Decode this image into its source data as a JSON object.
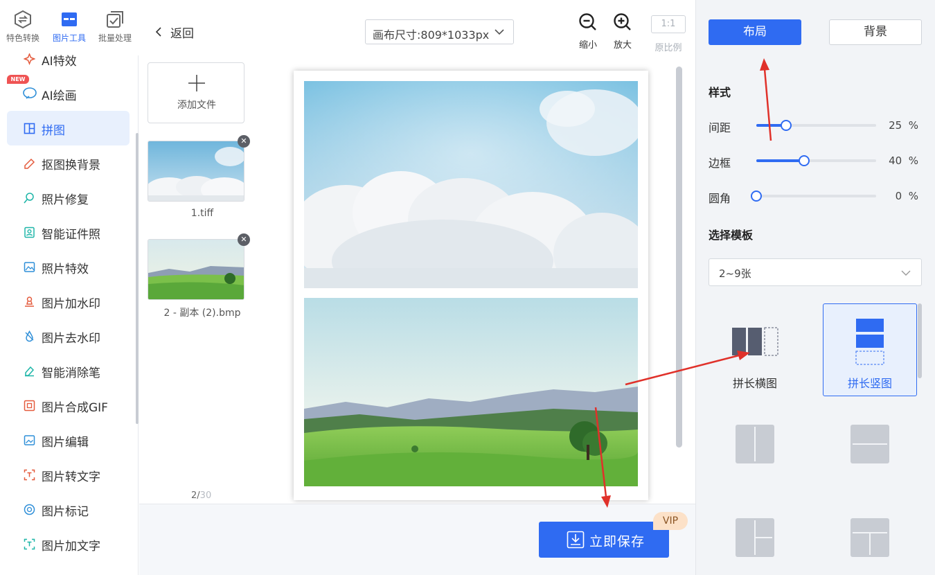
{
  "top_nav": [
    {
      "label": "特色转换",
      "icon": "convert-icon"
    },
    {
      "label": "图片工具",
      "icon": "image-tools-icon",
      "active": true
    },
    {
      "label": "批量处理",
      "icon": "batch-icon"
    }
  ],
  "menu": {
    "new_badge": "NEW",
    "items": [
      {
        "label": "AI特效",
        "icon": "ai-effect-icon"
      },
      {
        "label": "AI绘画",
        "icon": "ai-paint-icon"
      },
      {
        "label": "拼图",
        "icon": "collage-icon",
        "active": true
      },
      {
        "label": "抠图换背景",
        "icon": "cutout-icon"
      },
      {
        "label": "照片修复",
        "icon": "repair-icon"
      },
      {
        "label": "智能证件照",
        "icon": "id-photo-icon"
      },
      {
        "label": "照片特效",
        "icon": "photo-effect-icon"
      },
      {
        "label": "图片加水印",
        "icon": "add-watermark-icon"
      },
      {
        "label": "图片去水印",
        "icon": "remove-watermark-icon"
      },
      {
        "label": "智能消除笔",
        "icon": "eraser-icon"
      },
      {
        "label": "图片合成GIF",
        "icon": "gif-icon"
      },
      {
        "label": "图片编辑",
        "icon": "edit-icon"
      },
      {
        "label": "图片转文字",
        "icon": "ocr-icon"
      },
      {
        "label": "图片标记",
        "icon": "mark-icon"
      },
      {
        "label": "图片加文字",
        "icon": "add-text-icon"
      }
    ]
  },
  "files": {
    "add_label": "添加文件",
    "items": [
      {
        "name": "1.tiff"
      },
      {
        "name": "2 - 副本 (2).bmp"
      }
    ],
    "count_current": "2",
    "count_sep": "/",
    "count_total": "30"
  },
  "toolbar": {
    "back_label": "返回",
    "canvas_size": "画布尺寸:809*1033px",
    "zoom_out_label": "缩小",
    "zoom_in_label": "放大",
    "ratio_box": "1:1",
    "ratio_label": "原比例"
  },
  "save": {
    "label": "立即保存",
    "vip": "VIP"
  },
  "right_panel": {
    "tabs": {
      "layout": "布局",
      "background": "背景"
    },
    "style_title": "样式",
    "sliders": [
      {
        "label": "间距",
        "value": 25,
        "display": "25  %"
      },
      {
        "label": "边框",
        "value": 40,
        "display": "40  %"
      },
      {
        "label": "圆角",
        "value": 0,
        "display": "0  %"
      }
    ],
    "template_title": "选择模板",
    "template_select": "2~9张",
    "templates": [
      {
        "label": "拼长横图",
        "selected": false
      },
      {
        "label": "拼长竖图",
        "selected": true
      }
    ]
  },
  "colors": {
    "accent": "#2f6bf2",
    "annotation_arrow": "#e0312a"
  }
}
